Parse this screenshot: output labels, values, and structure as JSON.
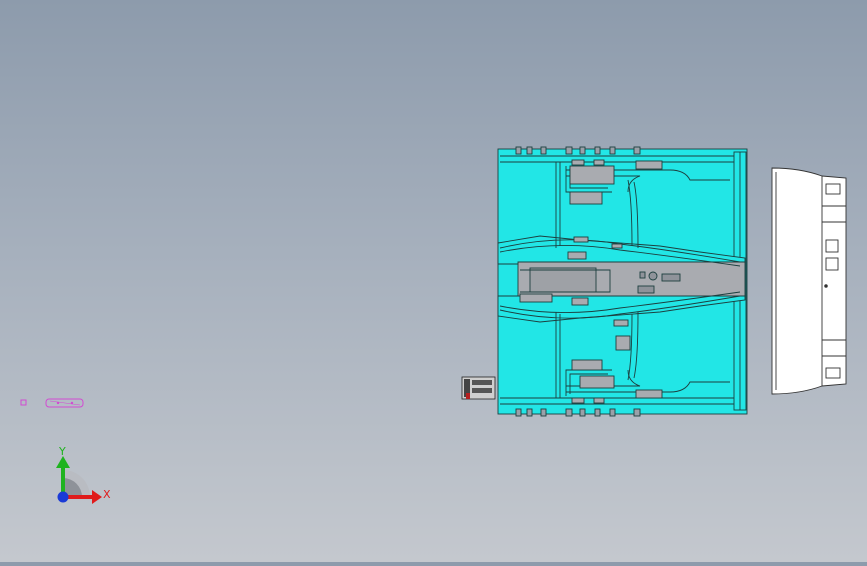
{
  "viewport": {
    "background_top": "#8d9bac",
    "background_bottom": "#c4c8ce"
  },
  "model": {
    "mold_color": "#22e6e6",
    "insert_color": "#a9abb0",
    "outline_color": "#1c3f3f",
    "side_part_color": "#ffffff",
    "small_part_color": "#d24ad2"
  },
  "triad": {
    "x_label": "X",
    "y_label": "Y",
    "x_color": "#e01b1b",
    "y_color": "#1fb31f",
    "z_color": "#1a3ad6"
  }
}
